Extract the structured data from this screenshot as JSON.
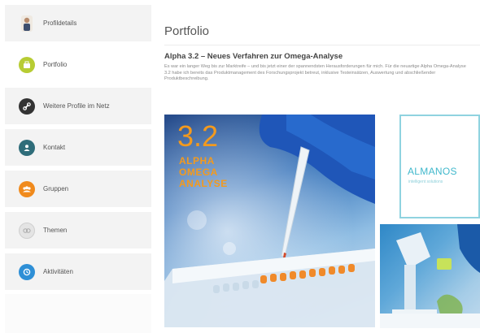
{
  "sidebar": {
    "items": [
      {
        "label": "Profildetails",
        "icon": "person-photo-icon",
        "color": "#e9e4dc",
        "active": false
      },
      {
        "label": "Portfolio",
        "icon": "portfolio-icon",
        "color": "#b7cc33",
        "active": true
      },
      {
        "label": "Weitere Profile im Netz",
        "icon": "link-icon",
        "color": "#333333",
        "active": false
      },
      {
        "label": "Kontakt",
        "icon": "contact-icon",
        "color": "#2f6d7a",
        "active": false
      },
      {
        "label": "Gruppen",
        "icon": "groups-icon",
        "color": "#f08a1c",
        "active": false
      },
      {
        "label": "Themen",
        "icon": "topics-icon",
        "color": "#e4e4e4",
        "active": false
      },
      {
        "label": "Aktivitäten",
        "icon": "activity-icon",
        "color": "#2e8fd6",
        "active": false
      }
    ]
  },
  "main": {
    "title": "Portfolio",
    "article_title": "Alpha 3.2 – Neues Verfahren zur Omega-Analyse",
    "article_text": "Es war ein langer Weg bis zur Marktreife – und bis jetzt einer der spannendsten Herausforderungen für mich. Für die neuartige Alpha Omega-Analyse 3.2 habe ich bereits das Produktmanagement des Forschungsprojekt betreut, inklusive Testeinsätzen, Auswertung und abschließender Produktbeschreibung."
  },
  "images": {
    "hero": {
      "number": "3.2",
      "line1": "ALPHA",
      "line2": "OMEGA",
      "line3": "ANALYSE"
    },
    "logo": {
      "name": "ALMANOS",
      "tagline": "intelligent solutions"
    }
  },
  "colors": {
    "accent_orange": "#f39a1e",
    "logo_teal": "#40b8cc"
  }
}
